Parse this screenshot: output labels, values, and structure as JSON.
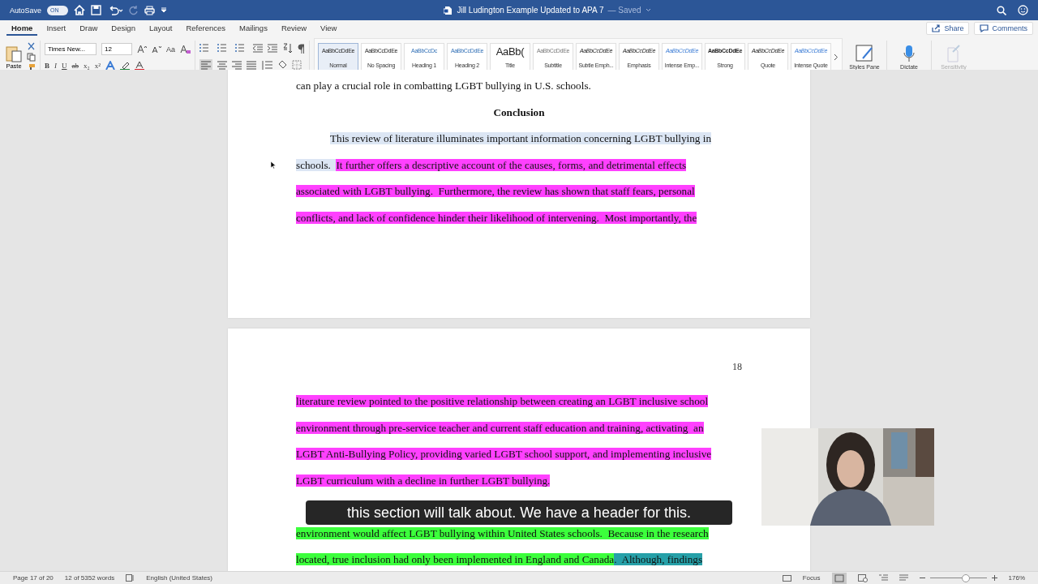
{
  "titlebar": {
    "autosave_label": "AutoSave",
    "autosave_toggle": {
      "label": "ON",
      "on": true
    },
    "title": "Jill Ludington Example Updated to APA 7",
    "status": "— Saved"
  },
  "tabs": [
    {
      "label": "Home",
      "selected": true
    },
    {
      "label": "Insert",
      "selected": false
    },
    {
      "label": "Draw",
      "selected": false
    },
    {
      "label": "Design",
      "selected": false
    },
    {
      "label": "Layout",
      "selected": false
    },
    {
      "label": "References",
      "selected": false
    },
    {
      "label": "Mailings",
      "selected": false
    },
    {
      "label": "Review",
      "selected": false
    },
    {
      "label": "View",
      "selected": false
    }
  ],
  "ribbon": {
    "paste": "Paste",
    "font_name": "Times New...",
    "font_size": "12",
    "case_button": "Aa",
    "format_buttons": [
      "B",
      "I",
      "U",
      "ab",
      "x₂",
      "x²"
    ],
    "styles": [
      {
        "sample": "AaBbCcDdEe",
        "label": "Normal",
        "selected": true,
        "kind": "normal"
      },
      {
        "sample": "AaBbCcDdEe",
        "label": "No Spacing",
        "selected": false,
        "kind": "normal"
      },
      {
        "sample": "AaBbCcDc",
        "label": "Heading 1",
        "selected": false,
        "kind": "heading"
      },
      {
        "sample": "AaBbCcDdEe",
        "label": "Heading 2",
        "selected": false,
        "kind": "heading"
      },
      {
        "sample": "AaBb(",
        "label": "Title",
        "selected": false,
        "kind": "title"
      },
      {
        "sample": "AaBbCcDdEe",
        "label": "Subtitle",
        "selected": false,
        "kind": "subtle"
      },
      {
        "sample": "AaBbCcDdEe",
        "label": "Subtle Emph...",
        "selected": false,
        "kind": "italic"
      },
      {
        "sample": "AaBbCcDdEe",
        "label": "Emphasis",
        "selected": false,
        "kind": "italic"
      },
      {
        "sample": "AaBbCcDdEe",
        "label": "Intense Emp...",
        "selected": false,
        "kind": "intense"
      },
      {
        "sample": "AaBbCcDdEe",
        "label": "Strong",
        "selected": false,
        "kind": "strong"
      },
      {
        "sample": "AaBbCcDdEe",
        "label": "Quote",
        "selected": false,
        "kind": "italic"
      },
      {
        "sample": "AaBbCcDdEe",
        "label": "Intense Quote",
        "selected": false,
        "kind": "intense"
      }
    ],
    "styles_pane": "Styles Pane",
    "dictate": "Dictate",
    "sensitivity": {
      "label": "Sensitivity",
      "disabled": true
    },
    "share": "Share",
    "comments": "Comments"
  },
  "page1": {
    "lines": [
      {
        "kind": "text",
        "segments": [
          {
            "text": "can play a crucial role in combatting LGBT bullying in U.S. schools."
          }
        ]
      },
      {
        "kind": "heading",
        "segments": [
          {
            "text": "Conclusion"
          }
        ]
      },
      {
        "kind": "indent",
        "segments": [
          {
            "text": "This review of literature illuminates important information concerning LGBT bullying in",
            "selected": true
          }
        ]
      },
      {
        "kind": "text",
        "segments": [
          {
            "text": "schools.  ",
            "selected": true
          },
          {
            "text": "It further offers a descriptive account of the causes, forms, and detrimental effects",
            "color": "#ff40ff"
          }
        ]
      },
      {
        "kind": "text",
        "segments": [
          {
            "text": "associated with LGBT bullying.  Furthermore, the review has shown that staff fears, personal",
            "color": "#ff40ff"
          }
        ]
      },
      {
        "kind": "text",
        "segments": [
          {
            "text": "conflicts, and lack of confidence hinder their likelihood of intervening.  Most importantly, the",
            "color": "#ff40ff"
          }
        ]
      }
    ]
  },
  "page2": {
    "page_number": "18",
    "lines": [
      {
        "kind": "text",
        "segments": [
          {
            "text": "literature review pointed to the positive relationship between creating an LGBT inclusive school",
            "color": "#ff40ff"
          }
        ]
      },
      {
        "kind": "text",
        "segments": [
          {
            "text": "environment through pre-service teacher and current staff education and training, activating  an",
            "color": "#ff40ff"
          }
        ]
      },
      {
        "kind": "text",
        "segments": [
          {
            "text": "LGBT Anti-Bullying Policy, providing varied LGBT school support, and implementing inclusive",
            "color": "#ff40ff"
          }
        ]
      },
      {
        "kind": "text",
        "segments": [
          {
            "text": "LGBT curriculum with a decline in further LGBT bullying.",
            "color": "#ff40ff"
          }
        ]
      },
      {
        "kind": "covered"
      },
      {
        "kind": "text",
        "segments": [
          {
            "text": "environment would affect LGBT bullying within United States schools.  Because in the research",
            "color": "#3cff3c"
          }
        ]
      },
      {
        "kind": "text",
        "segments": [
          {
            "text": "located, true inclusion had only been implemented in England and Canada",
            "color": "#3cff3c"
          },
          {
            "text": ".  Although, findings",
            "color": "#26a0a8"
          }
        ]
      }
    ]
  },
  "caption": "this section will talk about.  We have a header for this.",
  "status_bar": {
    "page": "Page 17 of 20",
    "words": "12 of 5352 words",
    "language": "English (United States)",
    "focus": "Focus",
    "zoom": "176%",
    "zoom_slider": {
      "level": 0.62
    }
  }
}
